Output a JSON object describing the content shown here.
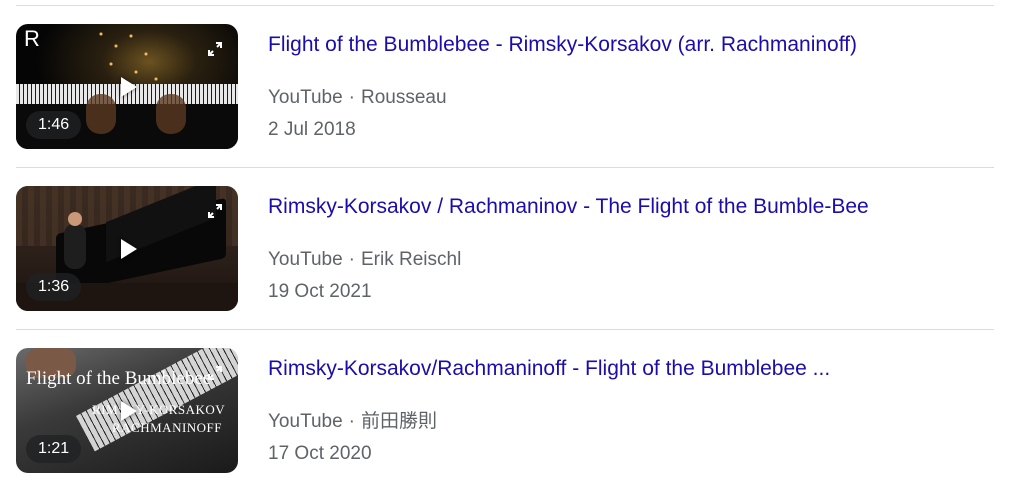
{
  "results": [
    {
      "title": "Flight of the Bumblebee - Rimsky-Korsakov (arr. Rachmaninoff)",
      "source": "YouTube",
      "channel": "Rousseau",
      "date": "2 Jul 2018",
      "duration": "1:46",
      "thumb_logo": "R"
    },
    {
      "title": "Rimsky-Korsakov / Rachmaninov - The Flight of the Bumble-Bee",
      "source": "YouTube",
      "channel": "Erik Reischl",
      "date": "19 Oct 2021",
      "duration": "1:36"
    },
    {
      "title": "Rimsky-Korsakov/Rachmaninoff - Flight of the Bumblebee ...",
      "source": "YouTube",
      "channel": "前田勝則",
      "date": "17 Oct 2020",
      "duration": "1:21",
      "thumb_text_1": "Flight of the Bumblebee",
      "thumb_text_2": "RIMSKY-KORSAKOV",
      "thumb_text_3": "RACHMANINOFF"
    }
  ],
  "separator": "·",
  "icons": {
    "play": "play-icon",
    "expand": "expand-icon"
  },
  "colors": {
    "link": "#1a0dab",
    "meta": "#5f6368",
    "divider": "#dadce0"
  }
}
